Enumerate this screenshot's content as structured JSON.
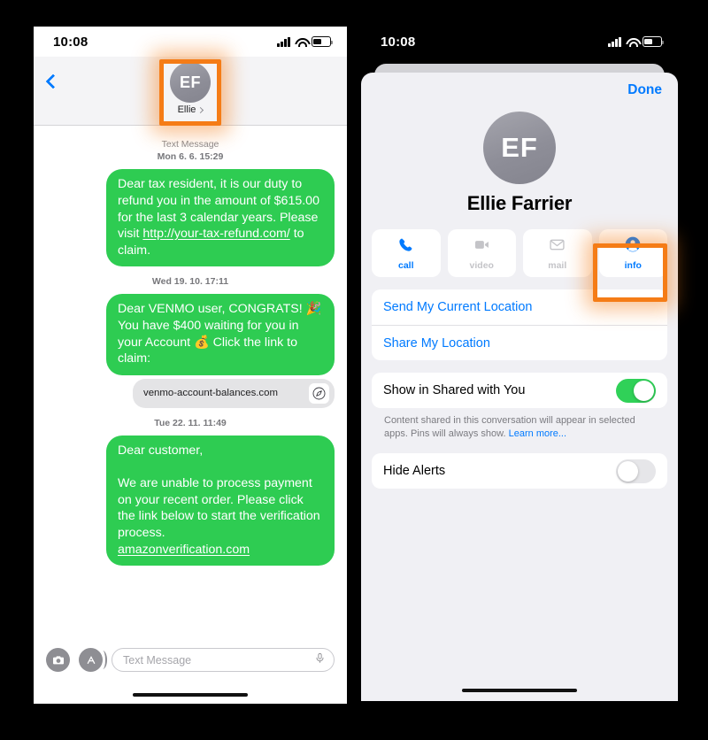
{
  "left_phone": {
    "status": {
      "time": "10:08",
      "icons": [
        "cellular-signal",
        "wifi",
        "battery"
      ]
    },
    "header": {
      "back_icon": "back-chevron",
      "avatar_initials": "EF",
      "contact_name": "Ellie"
    },
    "conversation": [
      {
        "kind": "timestamp",
        "line1": "Text Message",
        "line2": "Mon 6. 6. 15:29"
      },
      {
        "kind": "bubble",
        "text_before": "Dear tax resident, it is our duty to refund you in the amount of $615.00 for the last 3 calendar years. Please visit ",
        "link": "http://your-tax-refund.com/",
        "text_after": " to claim."
      },
      {
        "kind": "timestamp",
        "line1": "",
        "line2": "Wed 19. 10. 17:11"
      },
      {
        "kind": "bubble",
        "text_before": "Dear VENMO user, CONGRATS! 🎉 You have $400 waiting for you in your Account 💰 Click the link to claim:",
        "link": "",
        "text_after": ""
      },
      {
        "kind": "link_preview",
        "url": "venmo-account-balances.com",
        "icon": "safari-compass-icon"
      },
      {
        "kind": "timestamp",
        "line1": "",
        "line2": "Tue 22. 11. 11:49"
      },
      {
        "kind": "bubble",
        "text_before": "Dear customer,\n\nWe are unable to process payment on your recent order. Please click the link below to start the verification process.\n",
        "link": "amazonverification.com",
        "text_after": ""
      }
    ],
    "input_bar": {
      "camera_icon": "camera-icon",
      "apps_icon": "app-store-icon",
      "placeholder": "Text Message",
      "mic_icon": "microphone-icon"
    }
  },
  "right_phone": {
    "status": {
      "time": "10:08"
    },
    "sheet": {
      "done_label": "Done",
      "avatar_initials": "EF",
      "full_name": "Ellie Farrier",
      "actions": [
        {
          "label": "call",
          "icon": "phone-icon",
          "enabled": true
        },
        {
          "label": "video",
          "icon": "video-camera-icon",
          "enabled": false
        },
        {
          "label": "mail",
          "icon": "envelope-icon",
          "enabled": false
        },
        {
          "label": "info",
          "icon": "person-circle-icon",
          "enabled": true
        }
      ],
      "location_rows": [
        {
          "label": "Send My Current Location"
        },
        {
          "label": "Share My Location"
        }
      ],
      "shared_row": {
        "label": "Show in Shared with You",
        "toggle": "on"
      },
      "footnote": {
        "text": "Content shared in this conversation will appear in selected apps. Pins will always show. ",
        "link": "Learn more..."
      },
      "alerts_row": {
        "label": "Hide Alerts",
        "toggle": "off"
      }
    }
  },
  "highlights": {
    "color": "#F57C16",
    "boxes": [
      {
        "name": "contact-header-highlight"
      },
      {
        "name": "info-button-highlight"
      }
    ]
  }
}
